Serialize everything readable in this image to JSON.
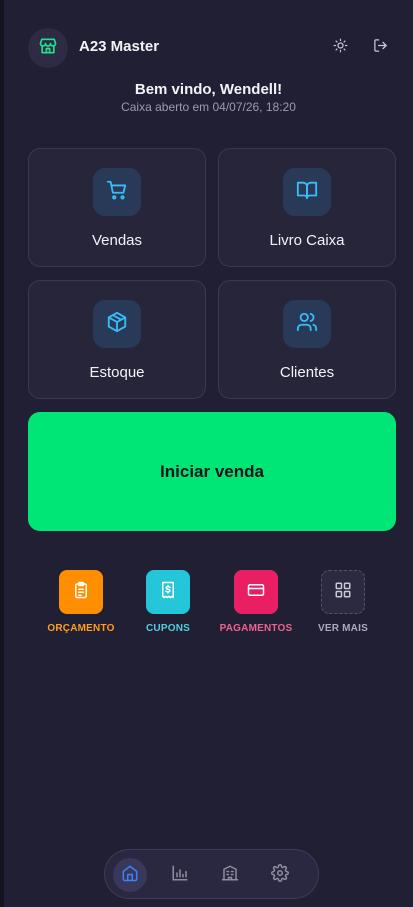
{
  "header": {
    "app_name": "A23 Master",
    "welcome": "Bem vindo, Wendell!",
    "caixa_status": "Caixa aberto em 04/07/26, 18:20"
  },
  "tiles": [
    {
      "label": "Vendas",
      "icon": "cart-icon"
    },
    {
      "label": "Livro Caixa",
      "icon": "book-icon"
    },
    {
      "label": "Estoque",
      "icon": "box-icon"
    },
    {
      "label": "Clientes",
      "icon": "users-icon"
    }
  ],
  "primary_action": {
    "label": "Iniciar venda",
    "color": "#00e676"
  },
  "quick_actions": [
    {
      "label": "ORÇAMENTO",
      "color": "#ff8f00",
      "icon": "clipboard-icon"
    },
    {
      "label": "CUPONS",
      "color": "#26c6da",
      "icon": "receipt-icon"
    },
    {
      "label": "PAGAMENTOS",
      "color": "#e91e63",
      "icon": "credit-card-icon"
    },
    {
      "label": "VER MAIS",
      "color": "#2b2a40",
      "icon": "grid-icon"
    }
  ],
  "bottom_nav": [
    {
      "icon": "home-icon",
      "active": true
    },
    {
      "icon": "bar-chart-icon",
      "active": false
    },
    {
      "icon": "store-icon",
      "active": false
    },
    {
      "icon": "settings-icon",
      "active": false
    }
  ],
  "colors": {
    "accent_blue": "#38bdf8",
    "background": "#211f33",
    "tile": "#272539"
  }
}
